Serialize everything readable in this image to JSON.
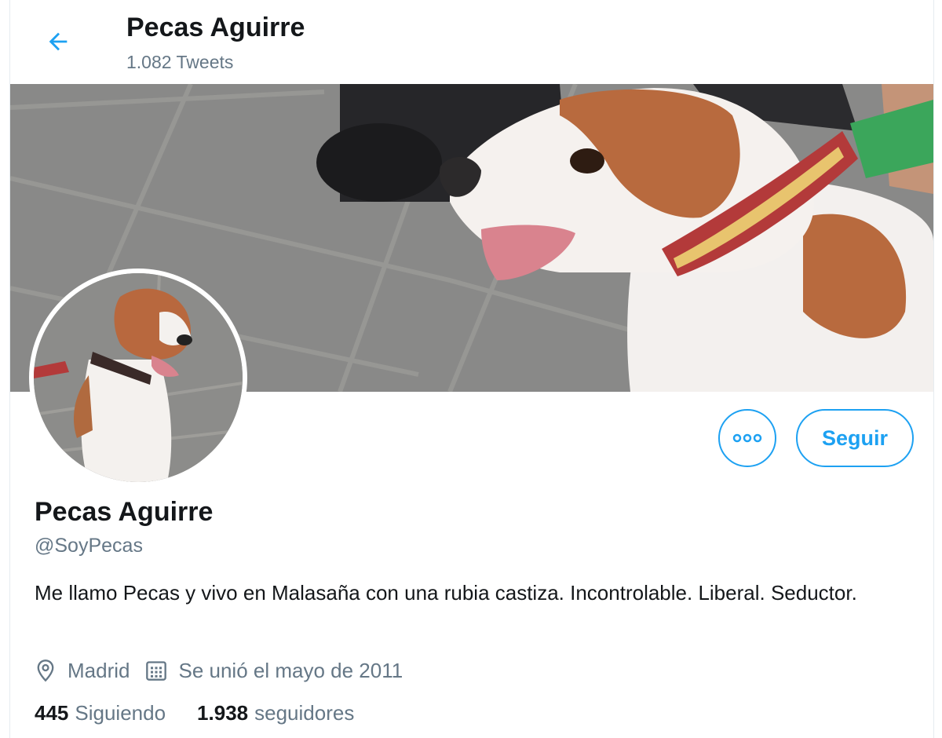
{
  "header": {
    "title": "Pecas Aguirre",
    "tweet_count": "1.082 Tweets"
  },
  "actions": {
    "more_icon": "more-dots-icon",
    "follow_label": "Seguir"
  },
  "profile": {
    "name": "Pecas Aguirre",
    "handle": "@SoyPecas",
    "bio": "Me llamo Pecas y vivo en Malasaña con una rubia castiza. Incontrolable. Liberal. Seductor.",
    "location": "Madrid",
    "joined": "Se unió el mayo de 2011"
  },
  "stats": {
    "following_count": "445",
    "following_label": "Siguiendo",
    "followers_count": "1.938",
    "followers_label": "seguidores"
  },
  "colors": {
    "accent": "#1da1f2",
    "text_primary": "#14171a",
    "text_secondary": "#657786"
  }
}
